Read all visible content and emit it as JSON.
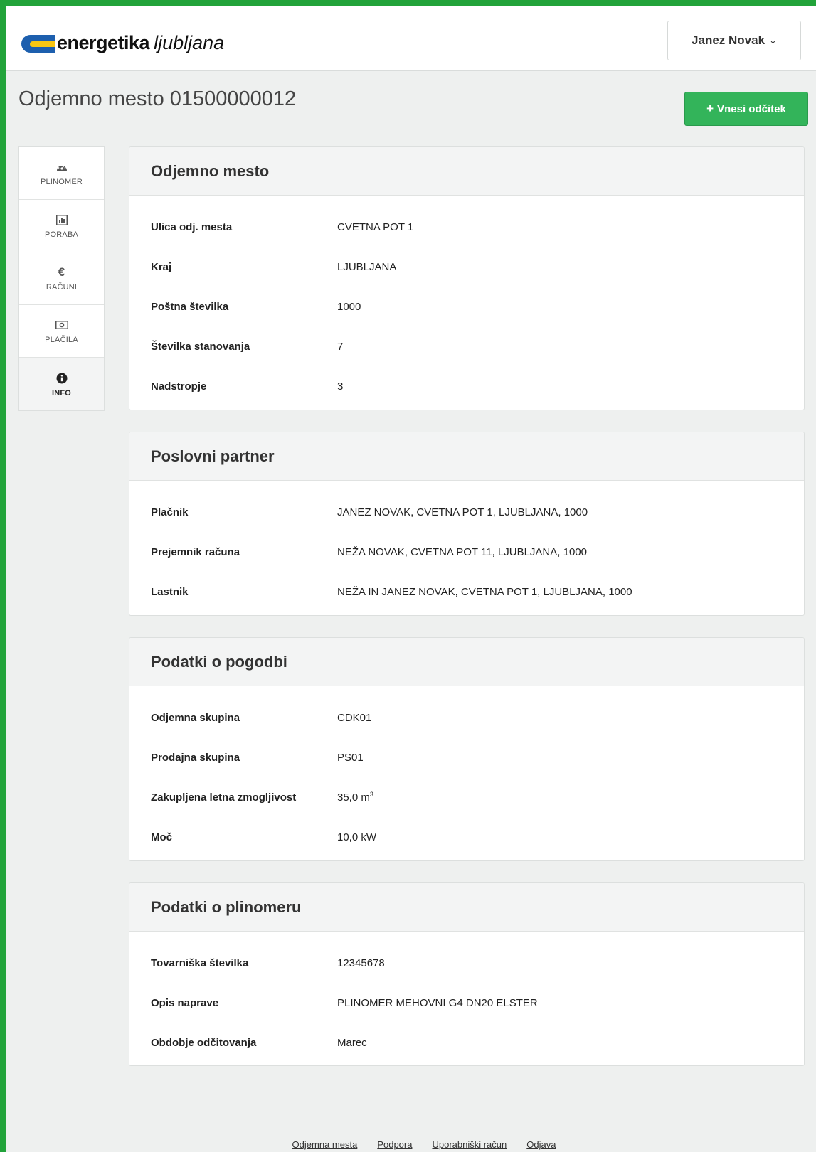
{
  "brand": {
    "name_bold": "energetika",
    "name_italic": "ljubljana",
    "colors": {
      "blue": "#1d5fae",
      "yellow": "#f7c613",
      "green": "#33b45a"
    }
  },
  "header": {
    "user_name": "Janez Novak",
    "user_menu_icon": "chevron-down-icon"
  },
  "page": {
    "title": "Odjemno mesto 01500000012",
    "add_reading_label": "Vnesi odčitek",
    "add_reading_icon": "plus-icon"
  },
  "sidebar": {
    "items": [
      {
        "label": "PLINOMER",
        "icon": "gauge-icon",
        "active": false
      },
      {
        "label": "PORABA",
        "icon": "bar-chart-icon",
        "active": false
      },
      {
        "label": "RAČUNI",
        "icon": "euro-icon",
        "active": false
      },
      {
        "label": "PLAČILA",
        "icon": "banknote-icon",
        "active": false
      },
      {
        "label": "INFO",
        "icon": "info-icon",
        "active": true
      }
    ]
  },
  "panels": {
    "odjemno_mesto": {
      "title": "Odjemno mesto",
      "rows": [
        {
          "label": "Ulica odj. mesta",
          "value": "CVETNA POT 1"
        },
        {
          "label": "Kraj",
          "value": "LJUBLJANA"
        },
        {
          "label": "Poštna številka",
          "value": "1000"
        },
        {
          "label": "Številka stanovanja",
          "value": "7"
        },
        {
          "label": "Nadstropje",
          "value": "3"
        }
      ]
    },
    "poslovni_partner": {
      "title": "Poslovni partner",
      "rows": [
        {
          "label": "Plačnik",
          "value": "JANEZ NOVAK, CVETNA POT 1, LJUBLJANA, 1000"
        },
        {
          "label": "Prejemnik računa",
          "value": "NEŽA NOVAK, CVETNA POT 11, LJUBLJANA, 1000"
        },
        {
          "label": "Lastnik",
          "value": "NEŽA IN JANEZ NOVAK, CVETNA POT 1, LJUBLJANA, 1000"
        }
      ]
    },
    "podatki_o_pogodbi": {
      "title": "Podatki o pogodbi",
      "rows": [
        {
          "label": "Odjemna skupina",
          "value": "CDK01"
        },
        {
          "label": "Prodajna skupina",
          "value": "PS01"
        },
        {
          "label": "Zakupljena letna zmogljivost",
          "value": "35,0 m",
          "unit_sup": "3"
        },
        {
          "label": "Moč",
          "value": "10,0 kW"
        }
      ]
    },
    "podatki_o_plinomeru": {
      "title": "Podatki o plinomeru",
      "rows": [
        {
          "label": "Tovarniška številka",
          "value": "12345678"
        },
        {
          "label": "Opis naprave",
          "value": "PLINOMER MEHOVNI G4 DN20 ELSTER"
        },
        {
          "label": "Obdobje odčitovanja",
          "value": "Marec"
        }
      ]
    }
  },
  "footer": {
    "links": [
      "Odjemna mesta",
      "Podpora",
      "Uporabniški račun",
      "Odjava"
    ]
  }
}
